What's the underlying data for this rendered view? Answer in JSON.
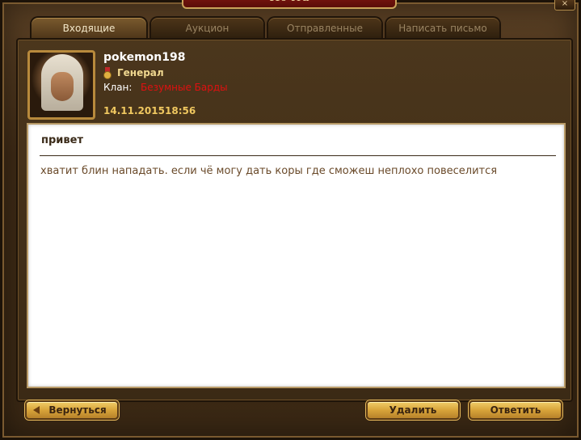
{
  "window": {
    "title": "Почта",
    "close_label": "×"
  },
  "tabs": [
    {
      "label": "Входящие",
      "active": true
    },
    {
      "label": "Аукцион",
      "active": false
    },
    {
      "label": "Отправленные",
      "active": false
    },
    {
      "label": "Написать письмо",
      "active": false
    }
  ],
  "sender": {
    "username": "pokemon198",
    "rank": "Генерал",
    "rank_icon": "medal-icon",
    "clan_label": "Клан:",
    "clan_name": "Безумные Барды",
    "date": "14.11.2015",
    "time": "18:56"
  },
  "message": {
    "subject": "привет",
    "body": "хватит блин нападать. если чё могу дать коры где сможеш неплохо повеселится"
  },
  "buttons": {
    "back": "Вернуться",
    "delete": "Удалить",
    "reply": "Ответить"
  },
  "colors": {
    "clan_name": "#e01010",
    "date": "#f0c860",
    "button_gold": "#d8a43a"
  }
}
